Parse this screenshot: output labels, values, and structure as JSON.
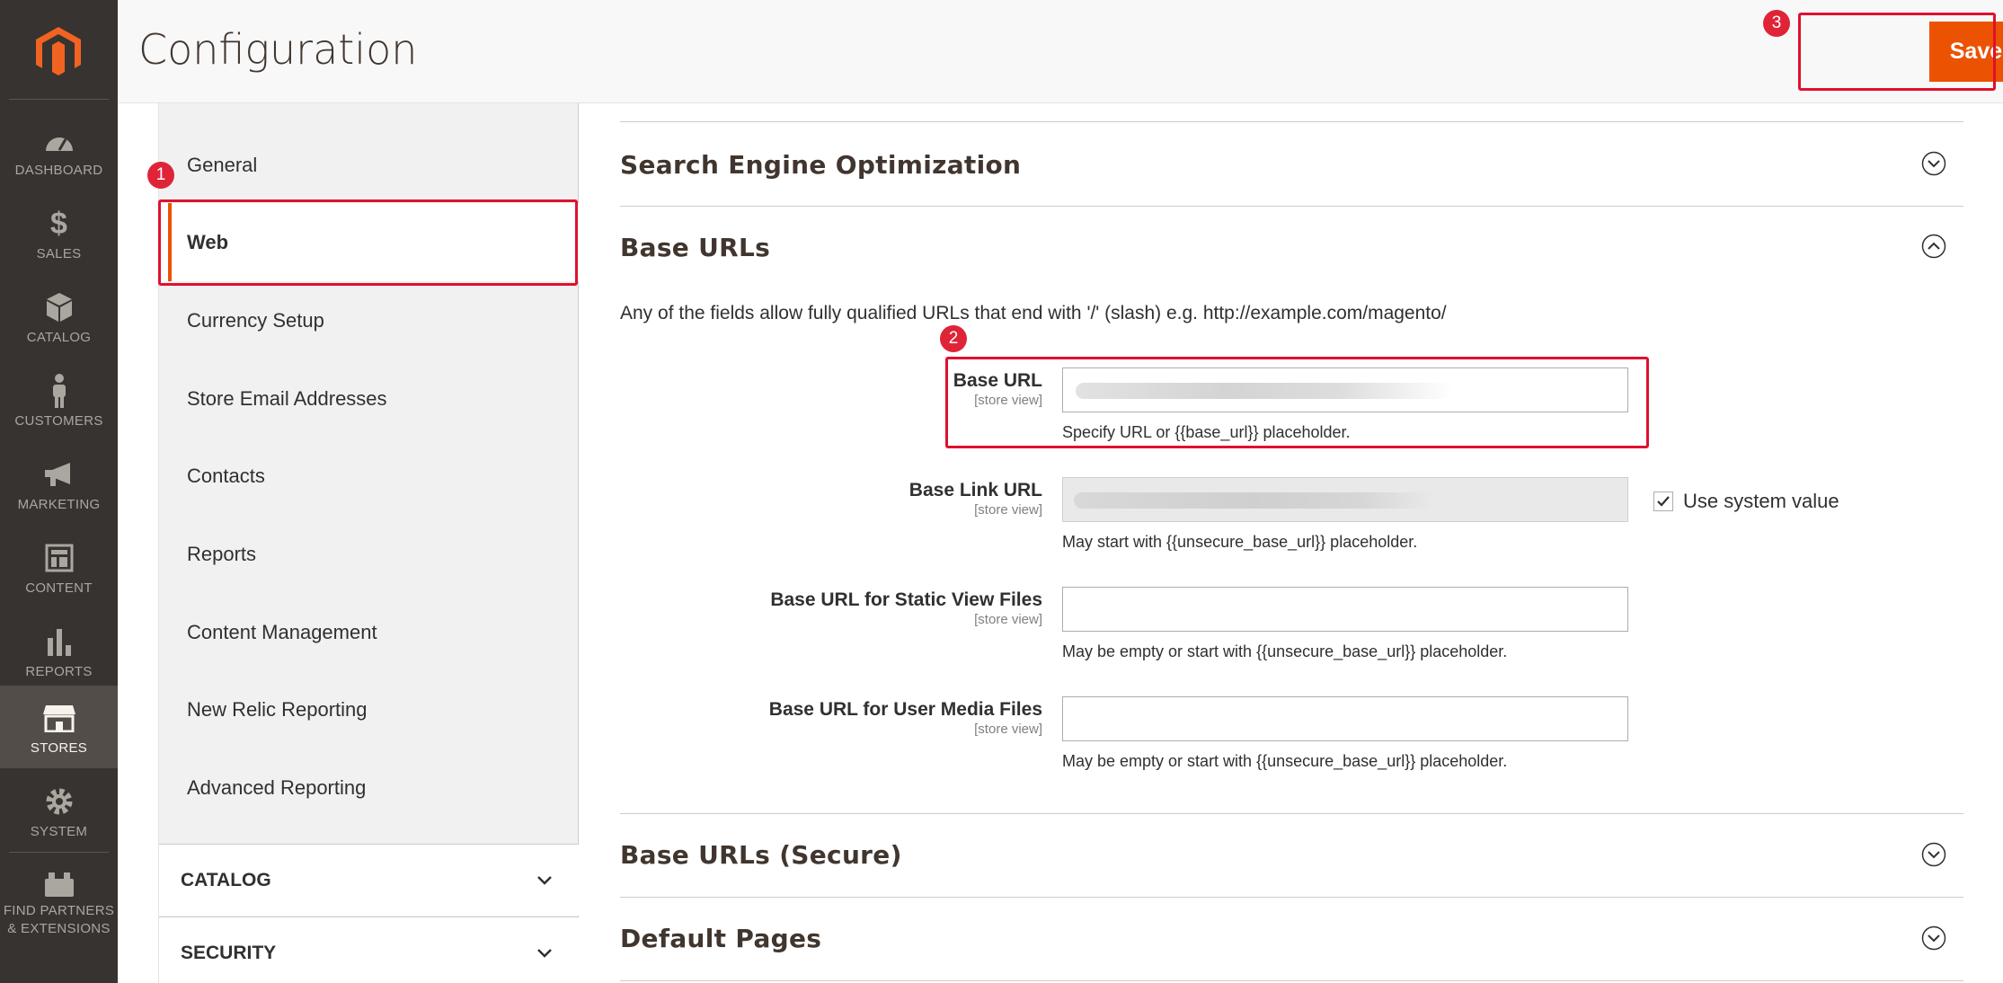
{
  "colors": {
    "accent": "#eb5202",
    "sidebar_bg": "#373330",
    "annotation": "#e0102e"
  },
  "header": {
    "title": "Configuration",
    "save_label": "Save Config"
  },
  "admin_nav": {
    "items": [
      {
        "label": "DASHBOARD",
        "icon": "dashboard-icon"
      },
      {
        "label": "SALES",
        "icon": "dollar-icon"
      },
      {
        "label": "CATALOG",
        "icon": "cube-icon"
      },
      {
        "label": "CUSTOMERS",
        "icon": "person-icon"
      },
      {
        "label": "MARKETING",
        "icon": "megaphone-icon"
      },
      {
        "label": "CONTENT",
        "icon": "layout-icon"
      },
      {
        "label": "REPORTS",
        "icon": "bar-chart-icon"
      },
      {
        "label": "STORES",
        "icon": "store-icon",
        "active": true
      },
      {
        "label": "SYSTEM",
        "icon": "gear-icon"
      },
      {
        "label_line1": "FIND PARTNERS",
        "label_line2": "& EXTENSIONS",
        "icon": "blocks-icon"
      }
    ]
  },
  "config_tabs": {
    "items": [
      {
        "label": "General"
      },
      {
        "label": "Web",
        "active": true
      },
      {
        "label": "Currency Setup"
      },
      {
        "label": "Store Email Addresses"
      },
      {
        "label": "Contacts"
      },
      {
        "label": "Reports"
      },
      {
        "label": "Content Management"
      },
      {
        "label": "New Relic Reporting"
      },
      {
        "label": "Advanced Reporting"
      }
    ],
    "groups": [
      {
        "label": "CATALOG"
      },
      {
        "label": "SECURITY"
      }
    ]
  },
  "sections": {
    "seo": {
      "title": "Search Engine Optimization"
    },
    "base_urls": {
      "title": "Base URLs",
      "note": "Any of the fields allow fully qualified URLs that end with '/' (slash) e.g. http://example.com/magento/",
      "fields": {
        "base_url": {
          "label": "Base URL",
          "scope": "[store view]",
          "note": "Specify URL or {{base_url}} placeholder."
        },
        "base_link_url": {
          "label": "Base Link URL",
          "scope": "[store view]",
          "note": "May start with {{unsecure_base_url}} placeholder.",
          "use_system_value": "Use system value"
        },
        "static_url": {
          "label": "Base URL for Static View Files",
          "scope": "[store view]",
          "note": "May be empty or start with {{unsecure_base_url}} placeholder."
        },
        "media_url": {
          "label": "Base URL for User Media Files",
          "scope": "[store view]",
          "note": "May be empty or start with {{unsecure_base_url}} placeholder."
        }
      }
    },
    "base_urls_secure": {
      "title": "Base URLs (Secure)"
    },
    "default_pages": {
      "title": "Default Pages"
    }
  },
  "annotations": {
    "badge1": "1",
    "badge2": "2",
    "badge3": "3"
  }
}
